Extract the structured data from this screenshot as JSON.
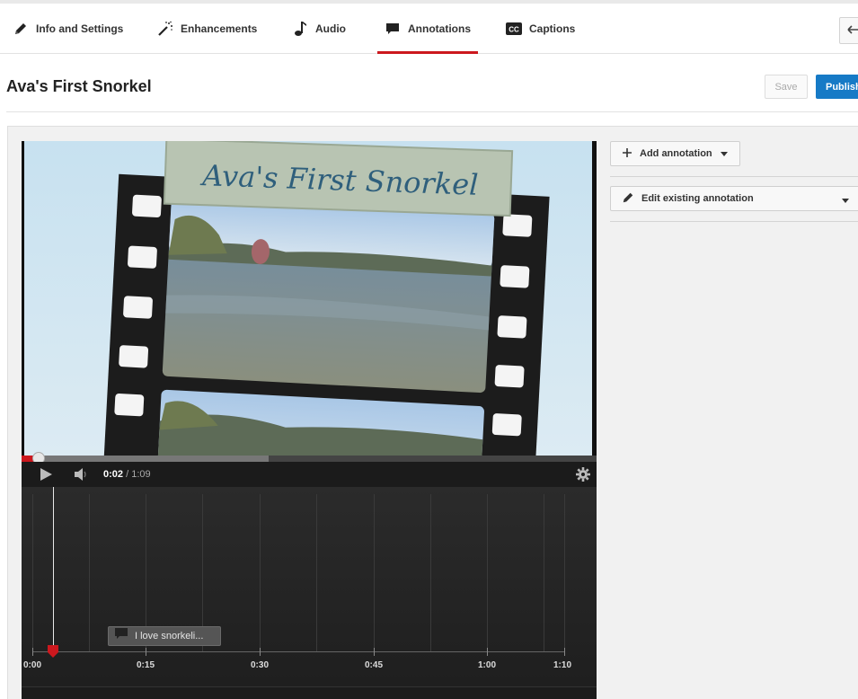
{
  "tabs": [
    {
      "label": "Info and Settings",
      "icon": "pencil-icon"
    },
    {
      "label": "Enhancements",
      "icon": "magic-wand-icon"
    },
    {
      "label": "Audio",
      "icon": "music-note-icon"
    },
    {
      "label": "Annotations",
      "icon": "speech-bubble-icon",
      "active": true
    },
    {
      "label": "Captions",
      "icon": "cc-icon"
    }
  ],
  "page": {
    "title": "Ava's First Snorkel",
    "save_label": "Save",
    "publish_label": "Publish"
  },
  "video": {
    "overlay_title": "Ava's First Snorkel"
  },
  "player": {
    "current_time": "0:02",
    "separator": " / ",
    "duration": "1:09",
    "progress_fraction": 0.03,
    "loaded_fraction": 0.43
  },
  "timeline": {
    "tick_labels": [
      "0:00",
      "0:15",
      "0:30",
      "0:45",
      "1:00",
      "1:10"
    ],
    "annotation_text": "I love snorkeli..."
  },
  "panel": {
    "add_annotation_label": "Add annotation",
    "edit_existing_label": "Edit existing annotation"
  },
  "colors": {
    "accent_red": "#cc181e",
    "publish_blue": "#167ac6"
  }
}
